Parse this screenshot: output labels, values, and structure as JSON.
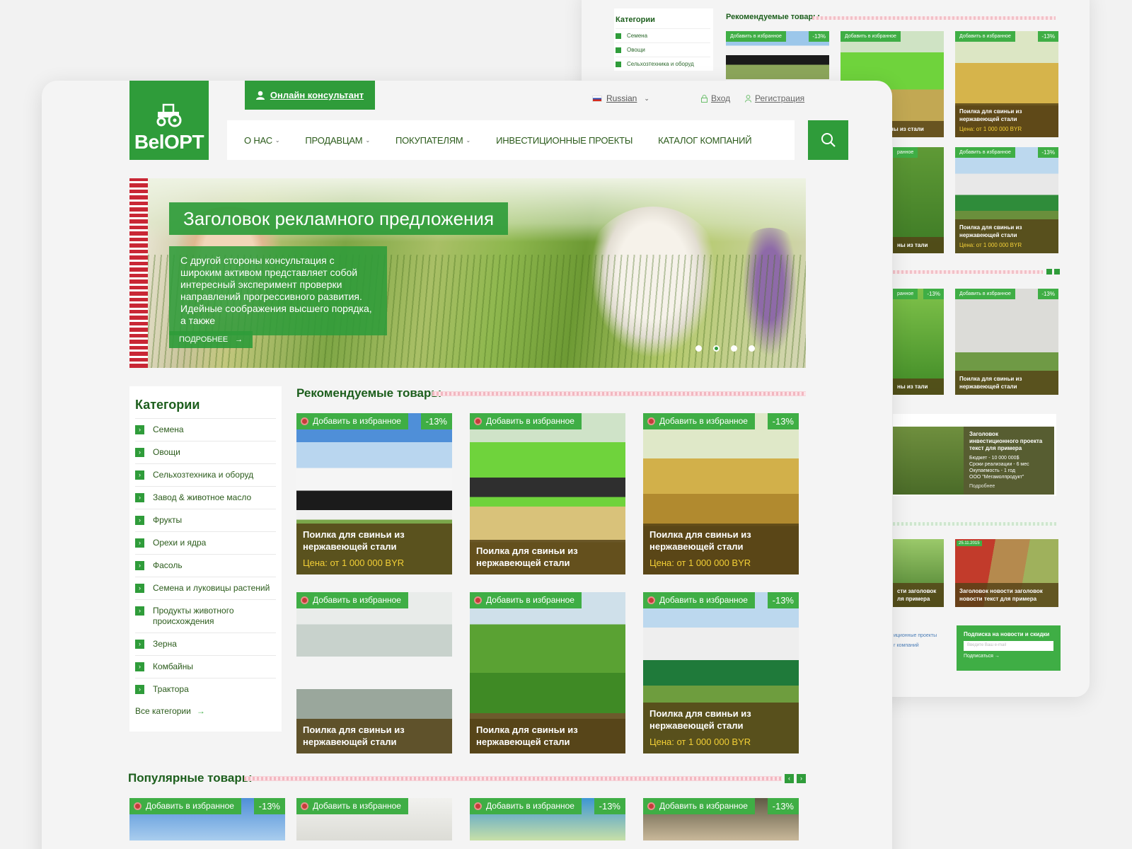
{
  "colors": {
    "primary": "#2f9c3a",
    "tile_badge": "#3fae45",
    "caption_bg": "#544216",
    "price": "#f2cf36",
    "ornament": "#c92735"
  },
  "back_page": {
    "categories": {
      "title": "Категории",
      "items": [
        "Семена",
        "Овощи",
        "Сельхозтехника и оборуд"
      ]
    },
    "recommended_title": "Рекомендуемые товары",
    "tiles": [
      {
        "fav": "Добавить в избранное",
        "discount": "-13%",
        "name": "",
        "price": ""
      },
      {
        "fav": "Добавить в избранное",
        "discount": "",
        "name": "ны из стали",
        "price": ""
      },
      {
        "fav": "Добавить в избранное",
        "discount": "-13%",
        "name": "Поилка для свиньи из нержавеющей стали",
        "price": "Цена: от 1 000 000 BYR"
      },
      {
        "fav": "ранное",
        "discount": "",
        "name": "ны из тали",
        "price": ""
      },
      {
        "fav": "Добавить в избранное",
        "discount": "-13%",
        "name": "Поилка для свиньи из нержавеющей стали",
        "price": "Цена: от 1 000 000 BYR"
      },
      {
        "fav": "ранное",
        "discount": "-13%",
        "name": "ны из тали",
        "price": ""
      },
      {
        "fav": "Добавить в избранное",
        "discount": "-13%",
        "name": "Поилка для свиньи из нержавеющей стали",
        "price": ""
      }
    ],
    "invest": {
      "title": "Заголовок инвестиционного проекта текст для примера",
      "lines": [
        "Бюджет - 10 000 000$",
        "Сроки реализации - 6 мес",
        "Окупаемость - 1 год",
        "ООО \"Мегамолпродукт\""
      ],
      "more": "Подробнее"
    },
    "news": [
      {
        "date": "",
        "title": "сти заголовок ля примера"
      },
      {
        "date": "25.11.2015",
        "title": "Заголовок новости заголовок новости текст для примера"
      }
    ],
    "footer_links": [
      "иционные проекты",
      "г компаний"
    ],
    "subscribe": {
      "title": "Подписка на новости и скидки",
      "placeholder": "Введите Ваш e-mail",
      "button": "Подписаться"
    }
  },
  "header": {
    "logo": "BelOPT",
    "consultant": "Онлайн консультант",
    "language": "Russian",
    "login": "Вход",
    "register": "Регистрация"
  },
  "nav": [
    "О НАС",
    "ПРОДАВЦАМ",
    "ПОКУПАТЕЛЯМ",
    "ИНВЕСТИЦИОННЫЕ ПРОЕКТЫ",
    "КАТАЛОГ КОМПАНИЙ"
  ],
  "hero": {
    "title": "Заголовок рекламного предложения",
    "text": "С другой стороны консультация с широким активом представляет собой интересный эксперимент проверки направлений прогрессивного развития. Идейные соображения высшего порядка, а также",
    "more": "ПОДРОБНЕЕ",
    "slides": 4,
    "active_slide": 2
  },
  "categories": {
    "title": "Категории",
    "items": [
      "Семена",
      "Овощи",
      "Сельхозтехника и оборуд",
      "Завод & животное масло",
      "Фрукты",
      "Орехи и ядра",
      "Фасоль",
      "Семена и луковицы растений",
      "Продукты животного происхождения",
      "Зерна",
      "Комбайны",
      "Трактора"
    ],
    "all": "Все категории"
  },
  "recommended": {
    "title": "Рекомендуемые товары",
    "products": [
      {
        "fav": "Добавить в избранное",
        "discount": "-13%",
        "name": "Поилка для свиньи из нержавеющей стали",
        "price": "Цена: от 1 000 000 BYR"
      },
      {
        "fav": "Добавить в избранное",
        "discount": "",
        "name": "Поилка для свиньи из нержавеющей стали",
        "price": ""
      },
      {
        "fav": "Добавить в избранное",
        "discount": "-13%",
        "name": "Поилка для свиньи из нержавеющей стали",
        "price": "Цена: от 1 000 000 BYR"
      },
      {
        "fav": "Добавить в избранное",
        "discount": "",
        "name": "Поилка для свиньи из нержавеющей стали",
        "price": ""
      },
      {
        "fav": "Добавить в избранное",
        "discount": "",
        "name": "Поилка для свиньи из нержавеющей стали",
        "price": ""
      },
      {
        "fav": "Добавить в избранное",
        "discount": "-13%",
        "name": "Поилка для свиньи из нержавеющей стали",
        "price": "Цена: от 1 000 000 BYR"
      }
    ]
  },
  "popular": {
    "title": "Популярные товары",
    "products": [
      {
        "fav": "Добавить в избранное",
        "discount": "-13%"
      },
      {
        "fav": "Добавить в избранное",
        "discount": ""
      },
      {
        "fav": "Добавить в избранное",
        "discount": "-13%"
      },
      {
        "fav": "Добавить в избранное",
        "discount": "-13%"
      }
    ]
  }
}
